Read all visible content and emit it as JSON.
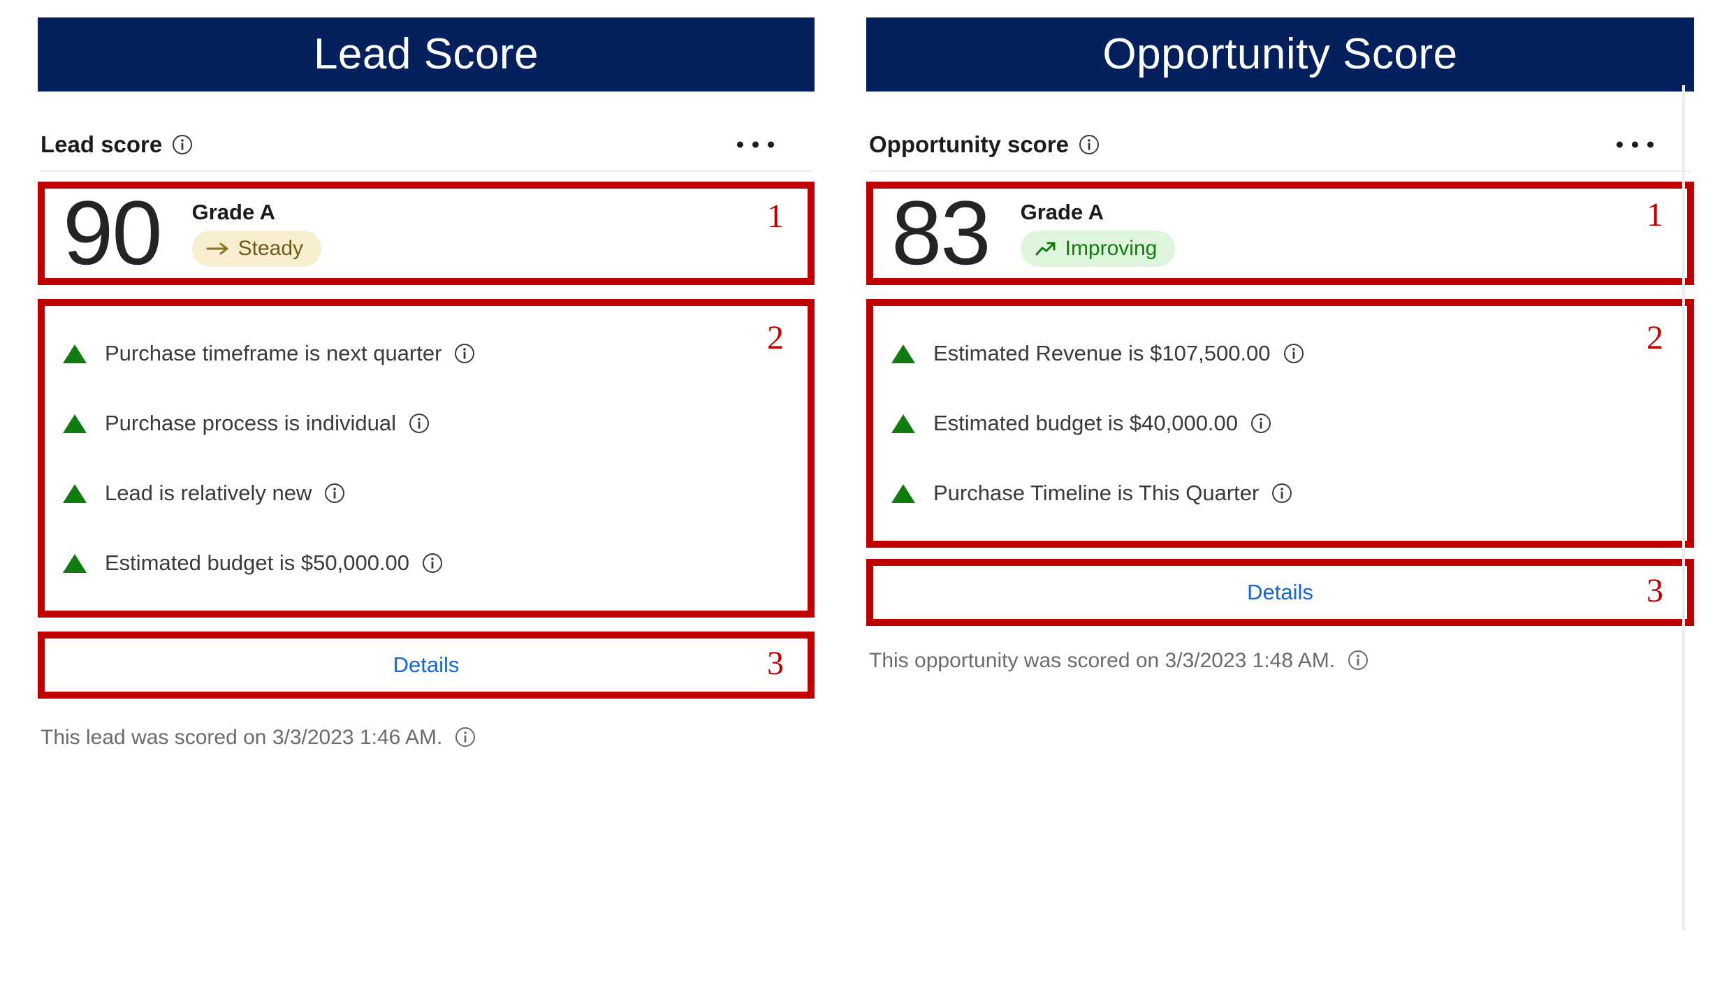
{
  "colors": {
    "banner_bg": "#04215E",
    "annotation_red": "#C00000",
    "link_blue": "#1266D6",
    "positive_green": "#107C10",
    "steady_pill_bg": "#F7EFD0",
    "improving_pill_bg": "#DFF6DC"
  },
  "left": {
    "banner_title": "Lead Score",
    "card_title": "Lead score",
    "title_info_icon": "info-icon",
    "overflow_icon": "ellipsis-icon",
    "score": {
      "value": "90",
      "grade": "Grade A",
      "trend_label": "Steady",
      "trend_icon": "arrow-right-icon",
      "annotation": "1"
    },
    "factors": {
      "annotation": "2",
      "items": [
        {
          "icon": "triangle-up-icon",
          "text": "Purchase timeframe is next quarter",
          "info_icon": "info-icon"
        },
        {
          "icon": "triangle-up-icon",
          "text": "Purchase process is individual",
          "info_icon": "info-icon"
        },
        {
          "icon": "triangle-up-icon",
          "text": "Lead is relatively new",
          "info_icon": "info-icon"
        },
        {
          "icon": "triangle-up-icon",
          "text": "Estimated budget is $50,000.00",
          "info_icon": "info-icon"
        }
      ]
    },
    "details": {
      "label": "Details",
      "annotation": "3"
    },
    "footer": {
      "text": "This lead was scored on 3/3/2023 1:46 AM.",
      "info_icon": "info-icon"
    }
  },
  "right": {
    "banner_title": "Opportunity Score",
    "card_title": "Opportunity score",
    "title_info_icon": "info-icon",
    "overflow_icon": "ellipsis-icon",
    "score": {
      "value": "83",
      "grade": "Grade A",
      "trend_label": "Improving",
      "trend_icon": "trend-up-icon",
      "annotation": "1"
    },
    "factors": {
      "annotation": "2",
      "items": [
        {
          "icon": "triangle-up-icon",
          "text": "Estimated Revenue is $107,500.00",
          "info_icon": "info-icon"
        },
        {
          "icon": "triangle-up-icon",
          "text": "Estimated budget is $40,000.00",
          "info_icon": "info-icon"
        },
        {
          "icon": "triangle-up-icon",
          "text": "Purchase Timeline is This Quarter",
          "info_icon": "info-icon"
        }
      ]
    },
    "details": {
      "label": "Details",
      "annotation": "3"
    },
    "footer": {
      "text": "This opportunity was scored on 3/3/2023 1:48 AM.",
      "info_icon": "info-icon"
    }
  }
}
